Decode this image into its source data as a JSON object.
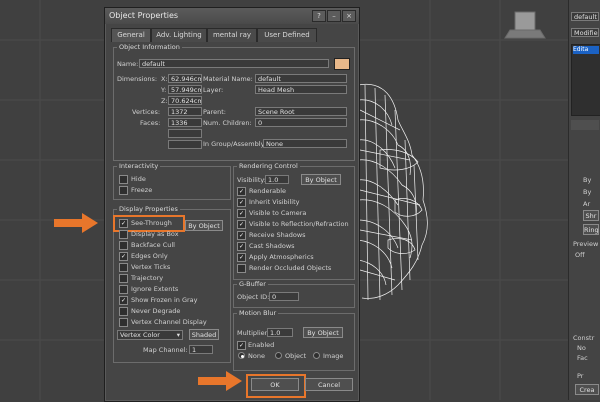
{
  "dialog": {
    "title": "Object Properties",
    "tabs": [
      "General",
      "Adv. Lighting",
      "mental ray",
      "User Defined"
    ],
    "object_information": {
      "group_label": "Object Information",
      "name_label": "Name:",
      "name_value": "default",
      "dimensions_label": "Dimensions:",
      "dim_x_label": "X:",
      "dim_x": "62.946cm",
      "dim_y_label": "Y:",
      "dim_y": "57.949cm",
      "dim_z_label": "Z:",
      "dim_z": "70.624cm",
      "material_name_label": "Material Name:",
      "material_name": "default",
      "layer_label": "Layer:",
      "layer": "Head Mesh",
      "vertices_label": "Vertices:",
      "vertices": "1372",
      "faces_label": "Faces:",
      "faces": "1336",
      "parent_label": "Parent:",
      "parent": "Scene Root",
      "num_children_label": "Num. Children:",
      "num_children": "0",
      "in_group_label": "In Group/Assembly:",
      "in_group": "None",
      "blank_fields": [
        "",
        ""
      ]
    },
    "interactivity": {
      "group_label": "Interactivity",
      "items": [
        {
          "label": "Hide",
          "checked": false
        },
        {
          "label": "Freeze",
          "checked": false
        }
      ]
    },
    "display_properties": {
      "group_label": "Display Properties",
      "by_object_label": "By Object",
      "items": [
        {
          "label": "See-Through",
          "checked": true
        },
        {
          "label": "Display as Box",
          "checked": false
        },
        {
          "label": "Backface Cull",
          "checked": false
        },
        {
          "label": "Edges Only",
          "checked": true
        },
        {
          "label": "Vertex Ticks",
          "checked": false
        },
        {
          "label": "Trajectory",
          "checked": false
        },
        {
          "label": "Ignore Extents",
          "checked": false
        },
        {
          "label": "Show Frozen in Gray",
          "checked": true
        },
        {
          "label": "Never Degrade",
          "checked": false
        },
        {
          "label": "Vertex Channel Display",
          "checked": false
        }
      ],
      "vertex_color_label": "Vertex Color",
      "shaded_label": "Shaded",
      "map_channel_label": "Map Channel:",
      "map_channel": "1"
    },
    "rendering_control": {
      "group_label": "Rendering Control",
      "visibility_label": "Visibility:",
      "visibility": "1.0",
      "by_object_label": "By Object",
      "items": [
        {
          "label": "Renderable",
          "checked": true
        },
        {
          "label": "Inherit Visibility",
          "checked": true
        },
        {
          "label": "Visible to Camera",
          "checked": true
        },
        {
          "label": "Visible to Reflection/Refraction",
          "checked": true
        },
        {
          "label": "Receive Shadows",
          "checked": true
        },
        {
          "label": "Cast Shadows",
          "checked": true
        },
        {
          "label": "Apply Atmospherics",
          "checked": true
        },
        {
          "label": "Render Occluded Objects",
          "checked": false
        }
      ]
    },
    "gbuffer": {
      "group_label": "G-Buffer",
      "object_id_label": "Object ID:",
      "object_id": "0"
    },
    "motion_blur": {
      "group_label": "Motion Blur",
      "multiplier_label": "Multiplier:",
      "multiplier": "1.0",
      "by_object_label": "By Object",
      "enabled_label": "Enabled",
      "enabled": true,
      "options": [
        {
          "label": "None",
          "selected": true
        },
        {
          "label": "Object",
          "selected": false
        },
        {
          "label": "Image",
          "selected": false
        }
      ]
    },
    "ok_label": "OK",
    "cancel_label": "Cancel"
  },
  "command_panel": {
    "object_name": "default",
    "modifier_list_label": "Modifier Li",
    "edit_label": "Edita",
    "fragments": [
      "By",
      "By",
      "Ar",
      "Shr",
      "Ring",
      "Preview",
      "Off",
      "Constr",
      "No",
      "Fac",
      "Pr",
      "Crea"
    ]
  },
  "colors": {
    "highlight": "#e8762b",
    "dialog_bg": "#454545",
    "viewport_bg": "#404040",
    "material_swatch": "#e8b88a",
    "selection_blue": "#1b62c4"
  }
}
